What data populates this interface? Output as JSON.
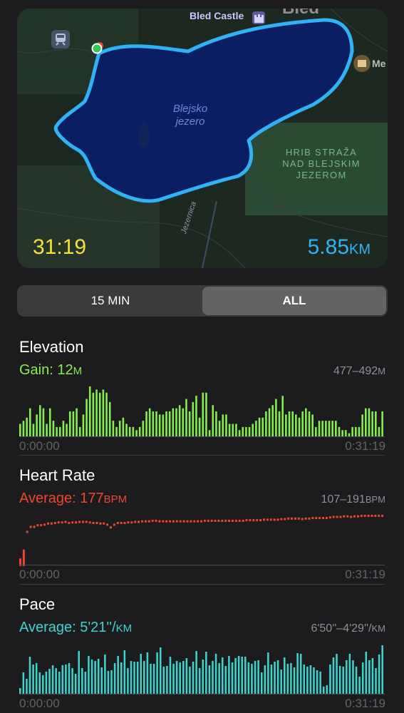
{
  "map": {
    "castle_label": "Bled Castle",
    "town_label": "Bled",
    "lake_label_line1": "Blejsko",
    "lake_label_line2": "jezero",
    "hill_label_line1": "HRIB STRAŽA",
    "hill_label_line2": "NAD BLEJSKIM",
    "hill_label_line3": "JEZEROM",
    "museum_label": "Me",
    "river_label": "Jezernica",
    "duration": "31:19",
    "distance_value": "5.85",
    "distance_unit": "KM",
    "route_color": "#2fb3f5",
    "duration_color": "#f3e234"
  },
  "segmented": {
    "options": [
      "15 MIN",
      "ALL"
    ],
    "selected": "ALL"
  },
  "elevation": {
    "title": "Elevation",
    "summary_label": "Gain: 12",
    "summary_unit": "M",
    "range_value": "477–492",
    "range_unit": "M",
    "start_time": "0:00:00",
    "end_time": "0:31:19",
    "color": "#86ee4f"
  },
  "heart_rate": {
    "title": "Heart Rate",
    "summary_label": "Average: 177",
    "summary_unit": "BPM",
    "range_value": "107–191",
    "range_unit": "BPM",
    "start_time": "0:00:00",
    "end_time": "0:31:19",
    "color": "#f2452c"
  },
  "pace": {
    "title": "Pace",
    "summary_label": "Average: 5'21''/",
    "summary_unit": "KM",
    "range_value": "6'50''–4'29''/",
    "range_unit": "KM",
    "start_time": "0:00:00",
    "end_time": "0:31:19",
    "color": "#3fd3cf"
  },
  "chart_data": [
    {
      "type": "bar",
      "title": "Elevation",
      "x_range": [
        "0:00:00",
        "0:31:19"
      ],
      "ylim": [
        477,
        492
      ],
      "y_unit": "m",
      "values": [
        480,
        481,
        482,
        485,
        480,
        483,
        486,
        485,
        480,
        485,
        481,
        479,
        479,
        481,
        480,
        484,
        484,
        485,
        479,
        483,
        488,
        492,
        490,
        491,
        490,
        491,
        490,
        487,
        481,
        479,
        481,
        482,
        480,
        479,
        479,
        478,
        479,
        481,
        484,
        485,
        484,
        484,
        483,
        483,
        484,
        484,
        485,
        485,
        486,
        485,
        488,
        484,
        487,
        489,
        482,
        490,
        490,
        478,
        486,
        484,
        481,
        483,
        483,
        480,
        480,
        480,
        478,
        479,
        479,
        479,
        480,
        481,
        482,
        482,
        484,
        485,
        486,
        488,
        484,
        489,
        483,
        484,
        484,
        483,
        482,
        484,
        485,
        484,
        483,
        479,
        481,
        481,
        481,
        481,
        481,
        481,
        479,
        478,
        478,
        477,
        479,
        479,
        479,
        483,
        485,
        485,
        484,
        484,
        479,
        484
      ],
      "series_color": "#86ee4f"
    },
    {
      "type": "line",
      "title": "Heart Rate",
      "x_range": [
        "0:00:00",
        "0:31:19"
      ],
      "ylim": [
        107,
        191
      ],
      "y_unit": "bpm",
      "values": [
        107,
        123,
        157,
        166,
        166,
        169,
        169,
        170,
        172,
        172,
        173,
        174,
        174,
        175,
        173,
        174,
        174,
        175,
        175,
        175,
        174,
        173,
        173,
        172,
        172,
        170,
        165,
        170,
        173,
        173,
        173,
        174,
        174,
        175,
        175,
        176,
        176,
        176,
        177,
        177,
        176,
        176,
        176,
        176,
        176,
        176,
        176,
        176,
        176,
        176,
        176,
        176,
        176,
        177,
        177,
        177,
        177,
        177,
        177,
        177,
        177,
        177,
        177,
        177,
        177,
        178,
        178,
        178,
        178,
        178,
        179,
        179,
        179,
        179,
        179,
        180,
        180,
        181,
        181,
        181,
        181,
        180,
        181,
        181,
        182,
        182,
        182,
        182,
        182,
        183,
        184,
        184,
        184,
        185,
        185,
        184,
        185,
        185,
        186,
        186,
        186,
        186,
        186,
        186,
        186
      ],
      "series_color": "#f2452c"
    },
    {
      "type": "bar",
      "title": "Pace",
      "x_range": [
        "0:00:00",
        "0:31:19"
      ],
      "y_unit": "min/km",
      "range": [
        "6'50''",
        "4'29''"
      ],
      "values": [
        8,
        30,
        21,
        52,
        41,
        43,
        30,
        26,
        31,
        35,
        40,
        36,
        31,
        40,
        41,
        43,
        36,
        28,
        60,
        36,
        31,
        53,
        48,
        46,
        49,
        37,
        55,
        32,
        33,
        43,
        53,
        44,
        61,
        36,
        46,
        45,
        45,
        56,
        46,
        58,
        42,
        42,
        58,
        65,
        38,
        39,
        52,
        42,
        46,
        44,
        46,
        50,
        38,
        45,
        60,
        36,
        48,
        59,
        40,
        46,
        56,
        43,
        51,
        39,
        53,
        44,
        50,
        53,
        52,
        52,
        44,
        42,
        46,
        47,
        30,
        40,
        58,
        41,
        45,
        47,
        34,
        51,
        42,
        43,
        37,
        57,
        56,
        41,
        38,
        40,
        37,
        33,
        31,
        10,
        12,
        41,
        51,
        56,
        39,
        38,
        47,
        56,
        47,
        38,
        24,
        44,
        59,
        47,
        50,
        36,
        55,
        68
      ]
    }
  ]
}
